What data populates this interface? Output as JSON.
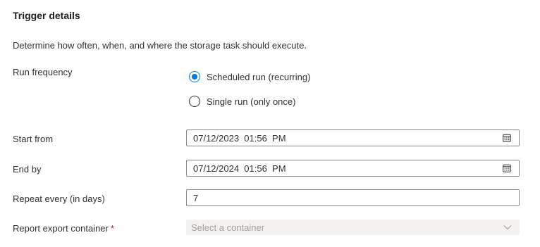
{
  "section": {
    "title": "Trigger details",
    "description": "Determine how often, when, and where the storage task should execute."
  },
  "run_frequency": {
    "label": "Run frequency",
    "options": [
      {
        "label": "Scheduled run (recurring)",
        "selected": true
      },
      {
        "label": "Single run (only once)",
        "selected": false
      }
    ]
  },
  "start_from": {
    "label": "Start from",
    "value": "07/12/2023  01:56  PM",
    "icon": "calendar-icon"
  },
  "end_by": {
    "label": "End by",
    "value": "07/12/2024  01:56  PM",
    "icon": "calendar-icon"
  },
  "repeat_every": {
    "label": "Repeat every (in days)",
    "value": "7"
  },
  "report_container": {
    "label": "Report export container",
    "required_marker": "*",
    "placeholder": "Select a container",
    "icon": "chevron-down-icon"
  },
  "colors": {
    "accent": "#0078d4",
    "required": "#a4262c",
    "disabled_bg": "#f3f2f1"
  }
}
